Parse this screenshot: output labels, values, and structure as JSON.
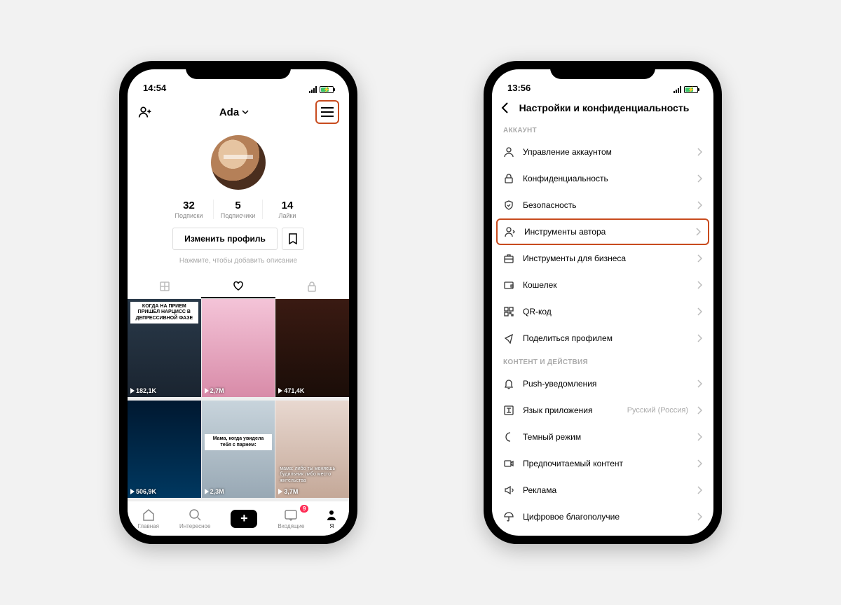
{
  "left": {
    "time": "14:54",
    "username": "Ada",
    "stats": [
      {
        "n": "32",
        "l": "Подписки"
      },
      {
        "n": "5",
        "l": "Подписчики"
      },
      {
        "n": "14",
        "l": "Лайки"
      }
    ],
    "edit_label": "Изменить профиль",
    "bio_hint": "Нажмите, чтобы добавить описание",
    "tiles": [
      {
        "views": "182,1K",
        "caption": "КОГДА НА ПРИЕМ ПРИШЕЛ НАРЦИСС В ДЕПРЕССИВНОЙ ФАЗЕ"
      },
      {
        "views": "2,7M"
      },
      {
        "views": "471,4K"
      },
      {
        "views": "506,9K"
      },
      {
        "views": "2,3M",
        "caption": "Мама, когда увидела тебя с парнем:"
      },
      {
        "views": "3,7M",
        "caption": "мама: либо ты меняешь будильник либо место жительства"
      }
    ],
    "nav": {
      "home": "Главная",
      "discover": "Интересное",
      "inbox": "Входящие",
      "me": "Я",
      "inbox_badge": "9"
    }
  },
  "right": {
    "time": "13:56",
    "title": "Настройки и конфиденциальность",
    "sections": [
      {
        "label": "АККАУНТ",
        "items": [
          {
            "icon": "user",
            "label": "Управление аккаунтом"
          },
          {
            "icon": "lock",
            "label": "Конфиденциальность"
          },
          {
            "icon": "shield",
            "label": "Безопасность"
          },
          {
            "icon": "creator",
            "label": "Инструменты автора",
            "highlight": true
          },
          {
            "icon": "briefcase",
            "label": "Инструменты для бизнеса"
          },
          {
            "icon": "wallet",
            "label": "Кошелек"
          },
          {
            "icon": "qr",
            "label": "QR-код"
          },
          {
            "icon": "share",
            "label": "Поделиться профилем"
          }
        ]
      },
      {
        "label": "КОНТЕНТ И ДЕЙСТВИЯ",
        "items": [
          {
            "icon": "bell",
            "label": "Push-уведомления"
          },
          {
            "icon": "lang",
            "label": "Язык приложения",
            "value": "Русский (Россия)"
          },
          {
            "icon": "moon",
            "label": "Темный режим"
          },
          {
            "icon": "video",
            "label": "Предпочитаемый контент"
          },
          {
            "icon": "ad",
            "label": "Реклама"
          },
          {
            "icon": "umbrella",
            "label": "Цифровое благополучие"
          }
        ]
      }
    ]
  }
}
